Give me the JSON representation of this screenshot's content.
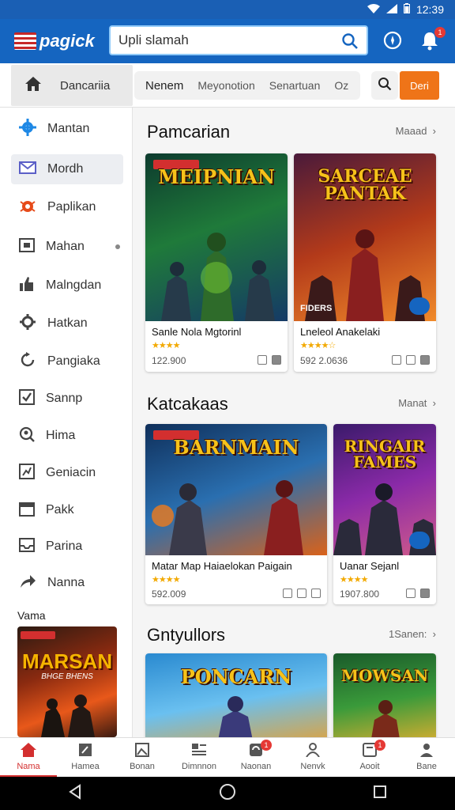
{
  "status": {
    "time": "12:39"
  },
  "header": {
    "logo_text": "pagick",
    "search_value": "Upli slamah",
    "notification_count": "1"
  },
  "tabrow": {
    "home_label": "Dancariia",
    "tabs": [
      "Nenem",
      "Meyonotion",
      "Senartuan",
      "Oz"
    ],
    "cta_label": "Deri"
  },
  "sidebar": {
    "items": [
      {
        "label": "Mantan",
        "icon": "gear-icon"
      },
      {
        "label": "Mordh",
        "icon": "mail-icon"
      },
      {
        "label": "Paplikan",
        "icon": "bug-icon"
      },
      {
        "label": "Mahan",
        "icon": "window-icon"
      },
      {
        "label": "Malngdan",
        "icon": "thumbs-up-icon"
      },
      {
        "label": "Hatkan",
        "icon": "settings-icon"
      },
      {
        "label": "Pangiaka",
        "icon": "refresh-icon"
      },
      {
        "label": "Sannp",
        "icon": "checkbox-icon"
      },
      {
        "label": "Hima",
        "icon": "search-user-icon"
      },
      {
        "label": "Geniacin",
        "icon": "chart-icon"
      },
      {
        "label": "Pakk",
        "icon": "calendar-icon"
      },
      {
        "label": "Parina",
        "icon": "inbox-icon"
      },
      {
        "label": "Nanna",
        "icon": "share-icon"
      }
    ],
    "featured_label": "Vama",
    "featured_title": "MARSAN",
    "featured_subtitle": "BHGE BHENS"
  },
  "sections": [
    {
      "title": "Pamcarian",
      "more": "Maaad",
      "cards": [
        {
          "name": "Sanle Nola Mgtorinl",
          "number": "122.900",
          "art_title": "MEIPNIAN",
          "art_colors": [
            "#0d3b2e",
            "#1f7a3a",
            "#153a66"
          ],
          "fig_color": "#2e6b2a"
        },
        {
          "name": "Lneleol Anakelaki",
          "number": "592 2.0636",
          "art_title": "SARCEAE PANTAK",
          "art_colors": [
            "#4a1a3a",
            "#b33a1a",
            "#f08a2a"
          ],
          "fig_color": "#8a1f1f",
          "caption": "FIDERS"
        }
      ]
    },
    {
      "title": "Katcakaas",
      "more": "Manat",
      "cards": [
        {
          "name": "Matar Map Haiaelokan Paigain",
          "number": "592.009",
          "art_title": "BARNMAIN",
          "art_colors": [
            "#0f2f5a",
            "#2a6fb0",
            "#d9621a"
          ],
          "fig_color": "#3a3a4a"
        },
        {
          "name": "Uanar Sejanl",
          "number": "1907.800",
          "art_title": "RINGAIR FAMES",
          "art_colors": [
            "#3a1a6a",
            "#8a2aa8",
            "#d05a8a"
          ],
          "fig_color": "#2a2a3a"
        }
      ]
    },
    {
      "title": "Gntyullors",
      "more": "1Sanen:",
      "cards": [
        {
          "art_title": "PONCARN",
          "art_colors": [
            "#2a8ad0",
            "#6ac0f0",
            "#e8a030"
          ],
          "fig_color": "#3a3a7a"
        },
        {
          "art_title": "MOWSAN",
          "art_colors": [
            "#1a5a2a",
            "#3a9a3a",
            "#e8b030"
          ],
          "fig_color": "#7a2a1a"
        }
      ]
    }
  ],
  "bottom_nav": [
    {
      "label": "Nama",
      "icon": "home-icon"
    },
    {
      "label": "Hamea",
      "icon": "edit-icon"
    },
    {
      "label": "Bonan",
      "icon": "image-icon"
    },
    {
      "label": "Dimnnon",
      "icon": "list-icon"
    },
    {
      "label": "Naonan",
      "icon": "sync-icon",
      "badge": "1"
    },
    {
      "label": "Nenvk",
      "icon": "person-icon"
    },
    {
      "label": "Aooit",
      "icon": "tablet-icon",
      "badge": "1"
    },
    {
      "label": "Bane",
      "icon": "account-icon"
    }
  ]
}
